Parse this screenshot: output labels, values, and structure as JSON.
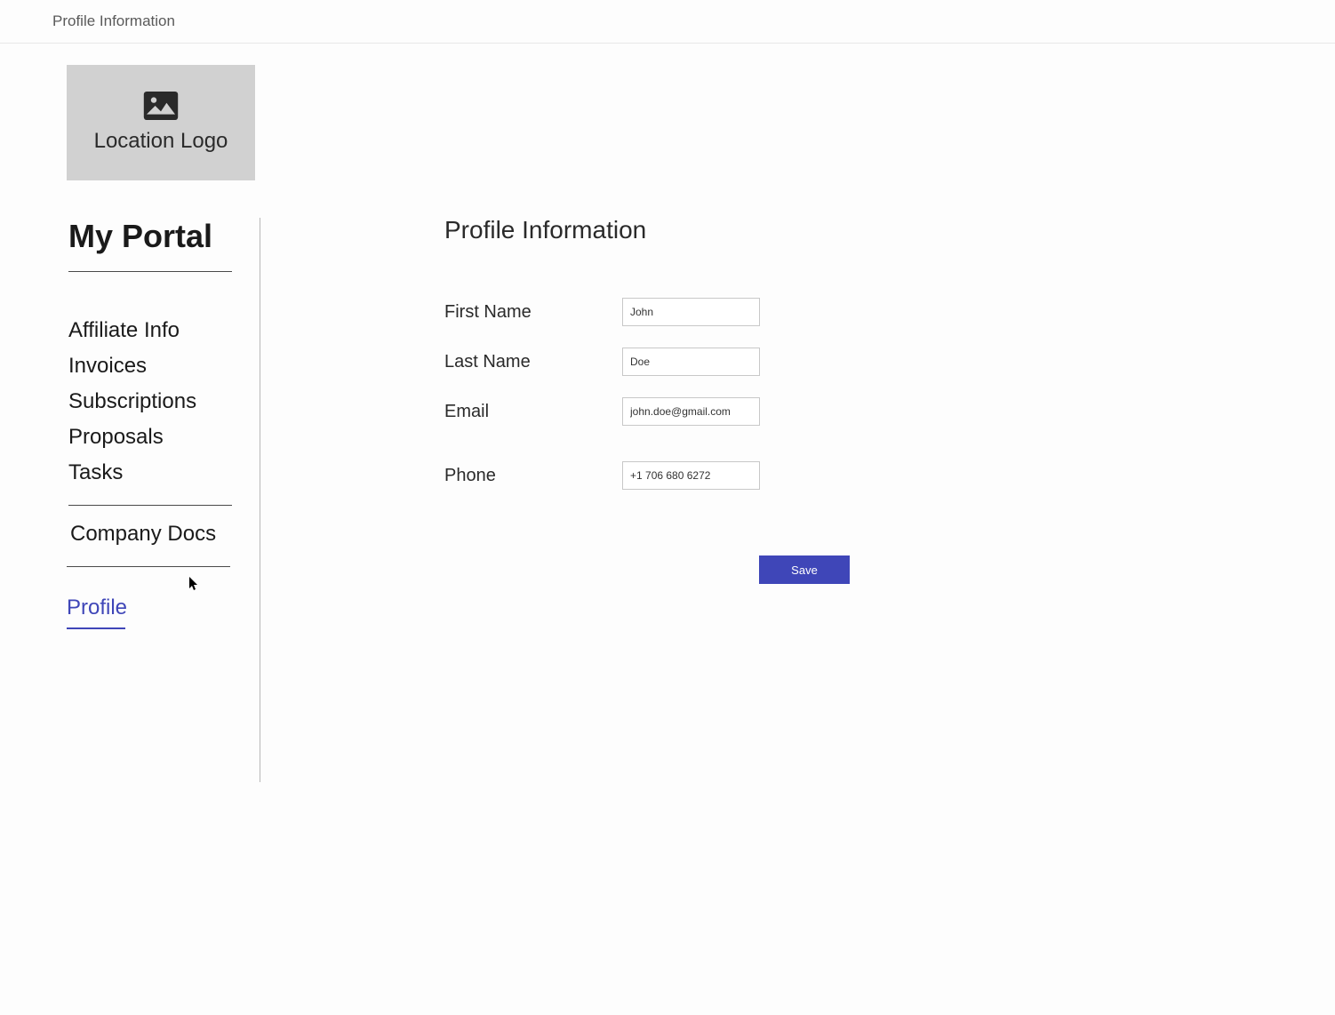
{
  "breadcrumb": "Profile Information",
  "logo": {
    "text": "Location Logo"
  },
  "sidebar": {
    "title": "My Portal",
    "nav": [
      "Affiliate Info",
      "Invoices",
      "Subscriptions",
      "Proposals",
      "Tasks"
    ],
    "docs": "Company Docs",
    "profile": "Profile"
  },
  "main": {
    "title": "Profile Information",
    "fields": {
      "first_name": {
        "label": "First Name",
        "value": "John"
      },
      "last_name": {
        "label": "Last Name",
        "value": "Doe"
      },
      "email": {
        "label": "Email",
        "value": "john.doe@gmail.com"
      },
      "phone": {
        "label": "Phone",
        "value": "+1 706 680 6272"
      }
    },
    "save": "Save"
  }
}
